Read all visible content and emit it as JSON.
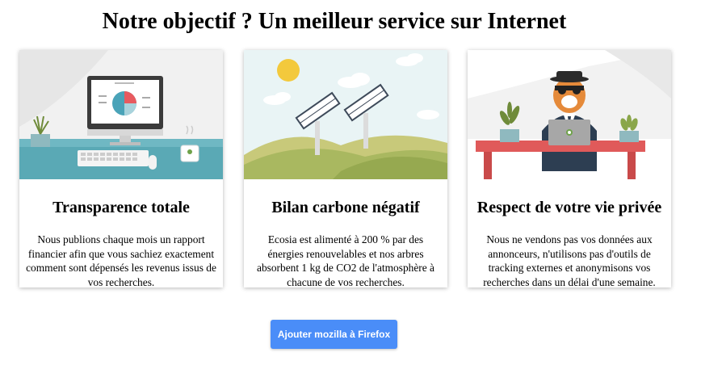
{
  "page": {
    "title": "Notre objectif ? Un meilleur service sur Internet"
  },
  "cards": [
    {
      "illustration": "desk-computer-illustration",
      "title": "Transparence totale",
      "text": "Nous publions chaque mois un rapport financier afin que vous sachiez exactement comment sont dépensés les revenus issus de vos recherches."
    },
    {
      "illustration": "solar-panels-hills-illustration",
      "title": "Bilan carbone négatif",
      "text": "Ecosia est alimenté à 200 % par des énergies renouvelables et nos arbres absorbent 1 kg de CO2 de l'atmosphère à chacune de vos recherches."
    },
    {
      "illustration": "tiger-spy-laptop-illustration",
      "title": "Respect de votre vie privée",
      "text": "Nous ne vendons pas vos données aux annonceurs, n'utilisons pas d'outils de tracking externes et anonymisons vos recherches dans un délai d'une semaine."
    }
  ],
  "cta": {
    "label": "Ajouter mozilla à Firefox",
    "color": "#4a8df8"
  }
}
